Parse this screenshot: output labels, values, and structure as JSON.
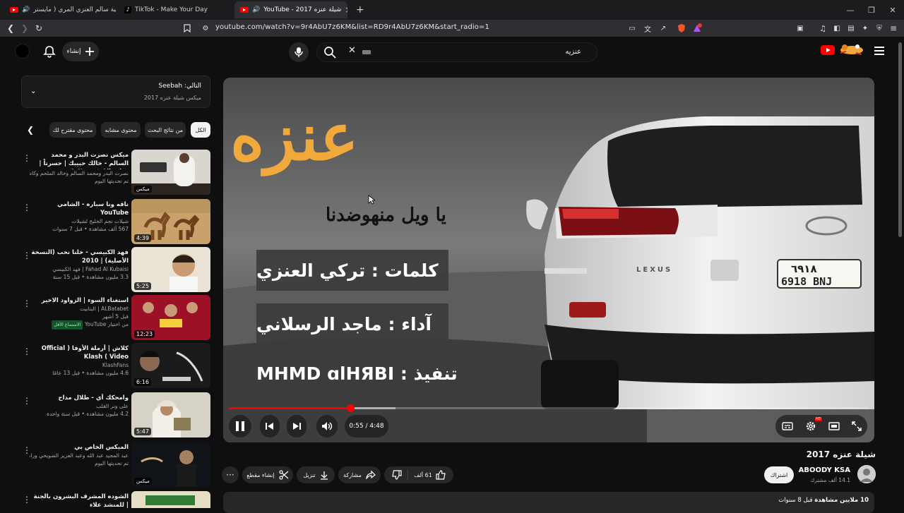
{
  "browser": {
    "tabs": [
      {
        "label": "منقية سالم العنزي المري ( مايستر",
        "active": false,
        "icon": "youtube-favicon",
        "audio": true
      },
      {
        "label": "TikTok - Make Your Day",
        "active": false,
        "icon": "tiktok-favicon",
        "audio": false
      },
      {
        "label": "YouTube - شيلة عنزه 2017",
        "active": true,
        "icon": "youtube-favicon",
        "audio": true
      }
    ],
    "new_tab": "+",
    "url": "youtube.com/watch?v=9r4AbU7z6KM&list=RD9r4AbU7z6KM&start_radio=1",
    "window_controls": [
      "minimize",
      "restore",
      "close"
    ]
  },
  "header": {
    "create_label": "إنشاء",
    "search_text": "عنزيه",
    "icons": [
      "avatar",
      "bell-icon",
      "create-icon",
      "mic-icon",
      "search-icon",
      "clear-icon",
      "youtube-logo",
      "menu-icon"
    ]
  },
  "playlist": {
    "now_playing": "التالي: Seebah",
    "subtitle": "ميكس شيلة عنزه 2017",
    "chips": [
      "الكل",
      "من نتائج البحث",
      "محتوى مشابه",
      "محتوى مقترح لك"
    ],
    "videos": [
      {
        "title": "ميكس نصرت البدر و محمد السالم - خالك حبيبك | حسرتاً | Nasrat Albader & ...",
        "meta1": "نصرت البدر ومحمد السالم وخالد الملحم وكاظم الساهر وآخرون",
        "meta2": "تم تحديثها اليوم",
        "badge": "ميكس",
        "duration": ""
      },
      {
        "title": "ناقه ونا سباره - الشامي YouTube",
        "meta1": "شيلات نجم الخليج لشيلات",
        "meta2": "567 ألف مشاهدة • قبل 7 سنوات",
        "badge": "",
        "duration": "4:39"
      },
      {
        "title": "فهد الكبيسي - خلنا نحب (النسخة الأصلية) | 2010",
        "meta1": "Fahad Al Kubaisi | فهد الكبيسي",
        "meta2": "3.3 مليون مشاهدة • قبل 15 سنة",
        "badge": "",
        "duration": "5:25"
      },
      {
        "title": "استغناء السوء | الزواود الاخير",
        "meta1": "ALBatabet | البتابيت",
        "meta2": "قبل 5 أشهر",
        "meta3": "من اختيار YouTube",
        "tag": "الاستماع الأقل",
        "badge": "",
        "duration": "12:23"
      },
      {
        "title": "كلاش | أرملة الأوفا ( Official Video ) Klash",
        "meta1": "KlashFans",
        "meta2": "4.6 مليون مشاهدة • قبل 13 عامًا",
        "badge": "",
        "duration": "6:16"
      },
      {
        "title": "وامحكك أي - طلال مداح",
        "meta1": "على وتر القلب",
        "meta2": "4.2 مليون مشاهدة • قبل سنة واحدة",
        "badge": "",
        "duration": "5:47"
      },
      {
        "title": "الميكس الخاص بي",
        "meta1": "عبد المجيد عبد الله وعبد العزيز الضويحي ورامي صبري ...",
        "meta2": "تم تحديثها اليوم",
        "badge": "ميكس",
        "duration": ""
      },
      {
        "title": "الشوده المشرف البشرون بالجنة | للمنشد علاء",
        "meta1": "",
        "meta2": "",
        "badge": "",
        "duration": ""
      }
    ]
  },
  "player": {
    "overlay_title": "عنزه",
    "overlay_subtitle": "يا ويل منهوضدنا",
    "overlay_lines": [
      "كلمات : تركي العنزي",
      "آداء : ماجد الرسلاني",
      "تنفيذ : MHMD ɑlHЯBI"
    ],
    "plate_number": "٦٩١٨",
    "plate_letters": "6918 BNJ",
    "car_badge": "LEXUS",
    "time": "0:55 / 4:48",
    "progress": 0.19,
    "buffered": 0.26,
    "icons": [
      "pause-icon",
      "previous-icon",
      "next-icon",
      "volume-icon",
      "subtitles-icon",
      "settings-icon",
      "miniplayer-icon",
      "fullscreen-icon"
    ],
    "hd_badge": "HD"
  },
  "video": {
    "title": "شيلة عنزه 2017",
    "channel": "ABOODY KSA",
    "subscribers": "14.1 ألف مشترك",
    "subscribe": "اشتراك",
    "likes": "61 ألف",
    "share": "مشاركة",
    "download": "تنزيل",
    "clip": "إنشاء مقطع",
    "views": "10 ملايين مشاهدة",
    "age": "قبل 8 سنوات"
  },
  "colors": {
    "accent": "#ff0000",
    "overlay_orange": "#f2a93b",
    "background": "#0f0f0f"
  }
}
